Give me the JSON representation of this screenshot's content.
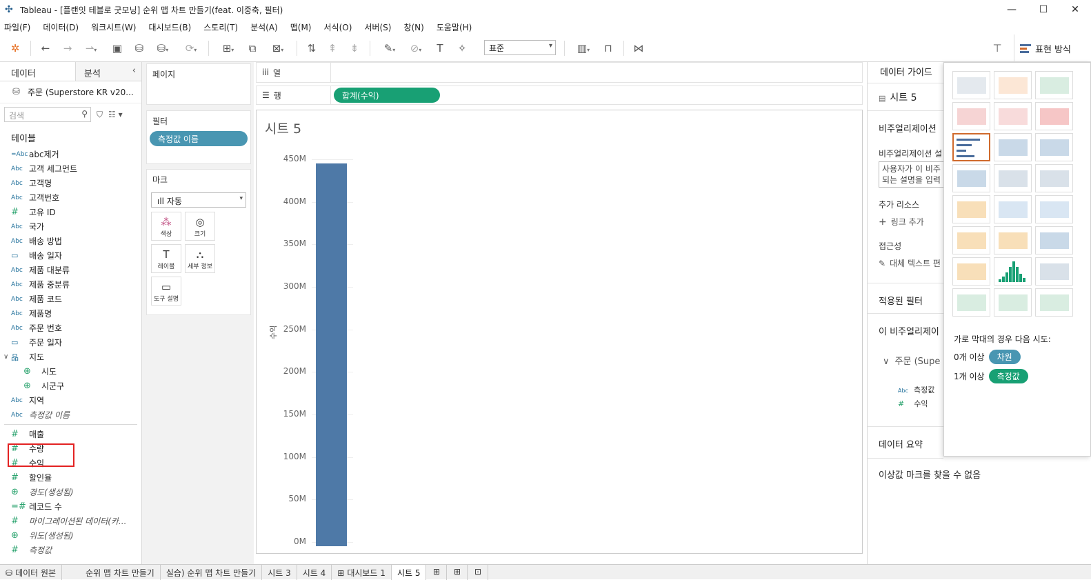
{
  "window": {
    "title": "Tableau - [플랜잇 테블로 굿모닝] 순위 맵 차트 만들기(feat. 이중축, 필터)"
  },
  "menu": [
    "파일(F)",
    "데이터(D)",
    "워크시트(W)",
    "대시보드(B)",
    "스토리(T)",
    "분석(A)",
    "맵(M)",
    "서식(O)",
    "서버(S)",
    "창(N)",
    "도움말(H)"
  ],
  "toolbar": {
    "fit_select": "표준",
    "show_me_label": "표현 방식"
  },
  "left_panel": {
    "tab_data": "데이터",
    "tab_analysis": "분석",
    "datasource": "주문 (Superstore KR v20...",
    "search_placeholder": "검색",
    "tables_heading": "테이블",
    "fields": [
      {
        "label": "abc제거",
        "type": "calc-abc",
        "icon": "=Abc"
      },
      {
        "label": "고객 세그먼트",
        "type": "abc",
        "icon": "Abc"
      },
      {
        "label": "고객명",
        "type": "abc",
        "icon": "Abc"
      },
      {
        "label": "고객번호",
        "type": "abc",
        "icon": "Abc"
      },
      {
        "label": "고유 ID",
        "type": "num",
        "icon": "#"
      },
      {
        "label": "국가",
        "type": "abc",
        "icon": "Abc"
      },
      {
        "label": "배송 방법",
        "type": "abc",
        "icon": "Abc"
      },
      {
        "label": "배송 일자",
        "type": "date",
        "icon": "▭"
      },
      {
        "label": "제품 대분류",
        "type": "abc",
        "icon": "Abc"
      },
      {
        "label": "제품 중분류",
        "type": "abc",
        "icon": "Abc"
      },
      {
        "label": "제품 코드",
        "type": "abc",
        "icon": "Abc"
      },
      {
        "label": "제품명",
        "type": "abc",
        "icon": "Abc"
      },
      {
        "label": "주문 번호",
        "type": "abc",
        "icon": "Abc"
      },
      {
        "label": "주문 일자",
        "type": "date",
        "icon": "▭"
      },
      {
        "label": "지도",
        "type": "hier",
        "icon": "品"
      },
      {
        "label": "시도",
        "type": "geo",
        "icon": "⊕",
        "sub": true
      },
      {
        "label": "시군구",
        "type": "geo",
        "icon": "⊕",
        "sub": true
      },
      {
        "label": "지역",
        "type": "abc",
        "icon": "Abc"
      },
      {
        "label": "측정값 이름",
        "type": "abc",
        "icon": "Abc",
        "italic": true
      }
    ],
    "measures": [
      {
        "label": "매출",
        "type": "num",
        "icon": "#"
      },
      {
        "label": "수량",
        "type": "num",
        "icon": "#"
      },
      {
        "label": "수익",
        "type": "num",
        "icon": "#"
      },
      {
        "label": "할인율",
        "type": "num",
        "icon": "#"
      },
      {
        "label": "경도(생성됨)",
        "type": "geo",
        "icon": "⊕",
        "italic": true
      },
      {
        "label": "레코드 수",
        "type": "num",
        "icon": "=#"
      },
      {
        "label": "마이그레이션된 데이터(카...",
        "type": "num",
        "icon": "#",
        "italic": true
      },
      {
        "label": "위도(생성됨)",
        "type": "geo",
        "icon": "⊕",
        "italic": true
      },
      {
        "label": "측정값",
        "type": "num",
        "icon": "#",
        "italic": true
      }
    ]
  },
  "cards": {
    "pages": "페이지",
    "filters": "필터",
    "filter_pill": "측정값 이름",
    "marks": "마크",
    "mark_type": "자동",
    "mark_buttons": [
      {
        "label": "색상",
        "glyph": "⁂"
      },
      {
        "label": "크기",
        "glyph": "◎"
      },
      {
        "label": "레이블",
        "glyph": "T"
      },
      {
        "label": "세부 정보",
        "glyph": "⛬"
      },
      {
        "label": "도구 설명",
        "glyph": "▭"
      }
    ]
  },
  "shelves": {
    "columns": "열",
    "rows": "행",
    "rows_pill": "합계(수익)"
  },
  "sheet_title": "시트 5",
  "chart_data": {
    "type": "bar",
    "categories": [
      ""
    ],
    "values": [
      445000000
    ],
    "ylabel": "수익",
    "ylim": [
      0,
      450000000
    ],
    "ticks": [
      "450M",
      "400M",
      "350M",
      "300M",
      "250M",
      "200M",
      "150M",
      "100M",
      "50M",
      "0M"
    ],
    "color": "#4e79a7"
  },
  "data_guide": {
    "title": "데이터 가이드",
    "sheet": "시트 5",
    "viz_heading": "비주얼리제이션",
    "viz_desc_label": "비주얼리제이션 설",
    "viz_desc_box_l1": "사용자가 이 비주",
    "viz_desc_box_l2": "되는 설명을 입력",
    "resources": "추가 리소스",
    "add_link": "링크 추가",
    "accessibility": "접근성",
    "alt_text": "대체 텍스트 편",
    "applied_filters": "적용된 필터",
    "this_viz": "이 비주얼리제이",
    "source": "주문 (Supe",
    "f1": "측정값 ",
    "f2": "수익",
    "summary": "데이터 요약",
    "outliers": "이상값 마크를 찾을 수 없음"
  },
  "show_me": {
    "hint": "가로 막대의 경우 다음 시도:",
    "row1_prefix": "0개 이상",
    "row1_pill": "차원",
    "row2_prefix": "1개 이상",
    "row2_pill": "측정값"
  },
  "tabs": [
    "데이터 원본",
    "순위 맵 차트 만들기",
    "실습) 순위 맵 차트 만들기",
    "시트 3",
    "시트 4",
    "대시보드 1",
    "시트 5"
  ]
}
